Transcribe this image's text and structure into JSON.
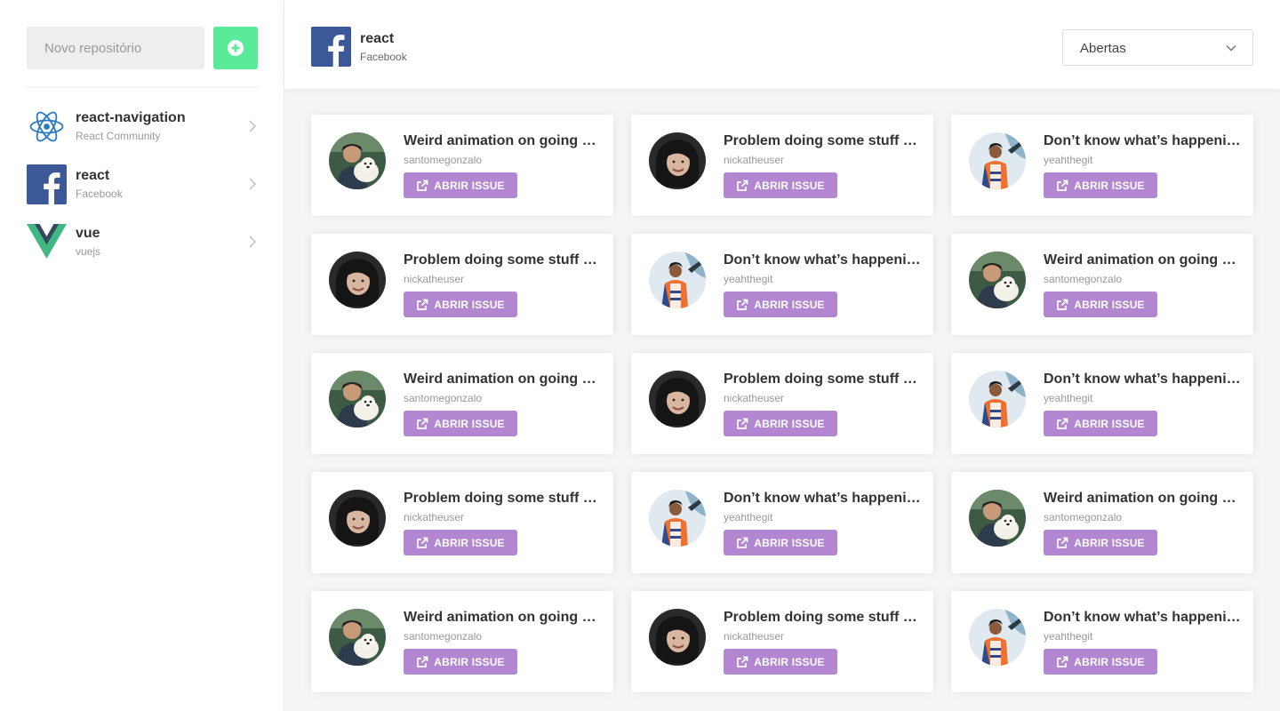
{
  "sidebar": {
    "input_placeholder": "Novo repositório",
    "add_icon": "plus-circle-icon",
    "repositories": [
      {
        "name": "react-navigation",
        "org": "React Community",
        "logo": "react-logo"
      },
      {
        "name": "react",
        "org": "Facebook",
        "logo": "facebook-logo"
      },
      {
        "name": "vue",
        "org": "vuejs",
        "logo": "vue-logo"
      }
    ]
  },
  "header": {
    "title": "react",
    "subtitle": "Facebook",
    "logo": "facebook-logo",
    "filter_value": "Abertas"
  },
  "colors": {
    "add_button": "#59ea9a",
    "open_button": "#b286d1",
    "facebook": "#3b5998"
  },
  "issues": [
    {
      "title": "Weird animation on going back",
      "user": "santomegonzalo",
      "button": "ABRIR ISSUE",
      "avatar": "avatar-santome"
    },
    {
      "title": "Problem doing some stuff with navigation",
      "user": "nickatheuser",
      "button": "ABRIR ISSUE",
      "avatar": "avatar-nicka"
    },
    {
      "title": "Don’t know what’s happening here",
      "user": "yeahthegit",
      "button": "ABRIR ISSUE",
      "avatar": "avatar-yeah"
    },
    {
      "title": "Problem doing some stuff with navigation",
      "user": "nickatheuser",
      "button": "ABRIR ISSUE",
      "avatar": "avatar-nicka"
    },
    {
      "title": "Don’t know what’s happening here",
      "user": "yeahthegit",
      "button": "ABRIR ISSUE",
      "avatar": "avatar-yeah"
    },
    {
      "title": "Weird animation on going back",
      "user": "santomegonzalo",
      "button": "ABRIR ISSUE",
      "avatar": "avatar-santome"
    },
    {
      "title": "Weird animation on going back",
      "user": "santomegonzalo",
      "button": "ABRIR ISSUE",
      "avatar": "avatar-santome"
    },
    {
      "title": "Problem doing some stuff with navigation",
      "user": "nickatheuser",
      "button": "ABRIR ISSUE",
      "avatar": "avatar-nicka"
    },
    {
      "title": "Don’t know what’s happening here",
      "user": "yeahthegit",
      "button": "ABRIR ISSUE",
      "avatar": "avatar-yeah"
    },
    {
      "title": "Problem doing some stuff with navigation",
      "user": "nickatheuser",
      "button": "ABRIR ISSUE",
      "avatar": "avatar-nicka"
    },
    {
      "title": "Don’t know what’s happening here",
      "user": "yeahthegit",
      "button": "ABRIR ISSUE",
      "avatar": "avatar-yeah"
    },
    {
      "title": "Weird animation on going back",
      "user": "santomegonzalo",
      "button": "ABRIR ISSUE",
      "avatar": "avatar-santome"
    },
    {
      "title": "Weird animation on going back",
      "user": "santomegonzalo",
      "button": "ABRIR ISSUE",
      "avatar": "avatar-santome"
    },
    {
      "title": "Problem doing some stuff with navigation",
      "user": "nickatheuser",
      "button": "ABRIR ISSUE",
      "avatar": "avatar-nicka"
    },
    {
      "title": "Don’t know what’s happening here",
      "user": "yeahthegit",
      "button": "ABRIR ISSUE",
      "avatar": "avatar-yeah"
    }
  ]
}
